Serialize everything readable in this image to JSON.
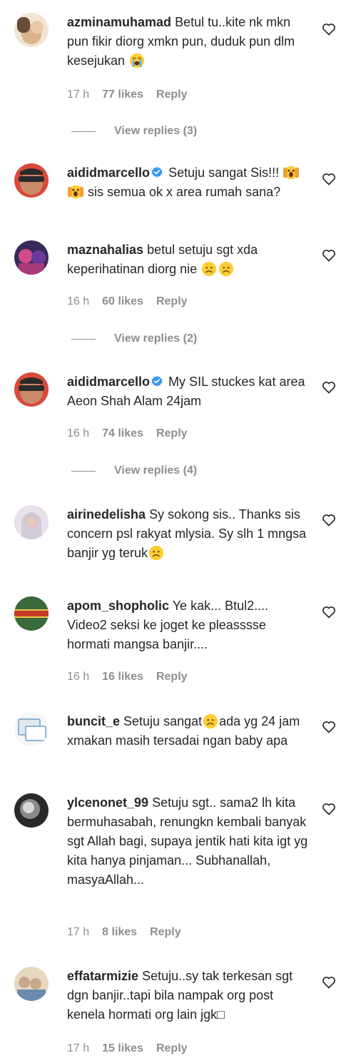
{
  "comments": [
    {
      "username": "azminamuhamad",
      "verified": false,
      "text_before": "Betul tu..kite nk mkn pun fikir diorg xmkn pun, duduk pun dlm kesejukan",
      "emojis": [
        "loudly-crying"
      ],
      "text_after": "",
      "time": "17 h",
      "likes": "77 likes",
      "reply": "Reply",
      "view_replies": "View replies (3)",
      "avatar_colors": [
        "#d9b48a",
        "#6a4b3a",
        "#f0e4d4"
      ]
    },
    {
      "username": "aididmarcello",
      "verified": true,
      "text_before": "Setuju sangat Sis!!!",
      "emojis": [
        "hands-on-cheeks",
        "hands-on-cheeks"
      ],
      "text_after": "sis semua ok x area rumah sana?",
      "time": "",
      "likes": "",
      "reply": "",
      "view_replies": "",
      "avatar_colors": [
        "#c98a6a",
        "#2a2a2a",
        "#d94a3a"
      ]
    },
    {
      "username": "maznahalias",
      "verified": false,
      "text_before": "betul setuju sgt xda keperihatinan diorg nie",
      "emojis": [
        "sad",
        "sad"
      ],
      "text_after": "",
      "time": "16 h",
      "likes": "60 likes",
      "reply": "Reply",
      "view_replies": "View replies (2)",
      "avatar_colors": [
        "#6a3a9a",
        "#d24a8a",
        "#3a2a5a"
      ]
    },
    {
      "username": "aididmarcello",
      "verified": true,
      "text_before": "My SIL stuckes kat area Aeon Shah Alam 24jam",
      "emojis": [],
      "text_after": "",
      "time": "16 h",
      "likes": "74 likes",
      "reply": "Reply",
      "view_replies": "View replies (4)",
      "avatar_colors": [
        "#c98a6a",
        "#2a2a2a",
        "#d94a3a"
      ]
    },
    {
      "username": "airinedelisha",
      "verified": false,
      "text_before": "Sy sokong sis.. Thanks sis concern psl rakyat mlysia. Sy slh 1 mngsa banjir yg teruk",
      "emojis": [
        "sad"
      ],
      "text_after": "",
      "time": "",
      "likes": "",
      "reply": "",
      "view_replies": "",
      "avatar_colors": [
        "#cfc4d8",
        "#8a7a9a",
        "#e8e0ea"
      ]
    },
    {
      "username": "apom_shopholic",
      "verified": false,
      "text_before": "Ye kak... Btul2.... Video2 seksi ke joget ke pleasssse hormati mangsa banjir....",
      "emojis": [],
      "text_after": "",
      "time": "16 h",
      "likes": "16 likes",
      "reply": "Reply",
      "view_replies": "",
      "avatar_colors": [
        "#3a6a3a",
        "#c83a2a",
        "#e8c84a"
      ]
    },
    {
      "username": "buncit_e",
      "verified": false,
      "text_before": "Setuju sangat",
      "emojis": [
        "sad"
      ],
      "text_after": "ada yg 24 jam xmakan masih tersadai ngan baby apa",
      "time": "",
      "likes": "",
      "reply": "",
      "view_replies": "",
      "avatar_colors": [
        "#dfe8ee",
        "#6aa0c8",
        "#f4f6f8"
      ]
    },
    {
      "username": "ylcenonet_99",
      "verified": false,
      "text_before": "Setuju sgt.. sama2 lh kita bermuhasabah, renungkn kembali banyak sgt Allah bagi, supaya jentik hati kita igt yg kita hanya pinjaman... Subhanallah, masyaAllah...",
      "emojis": [],
      "text_after": "",
      "time": "17 h",
      "likes": "8 likes",
      "reply": "Reply",
      "view_replies": "",
      "avatar_colors": [
        "#2a2a2a",
        "#8a8a8a",
        "#d8d8d8"
      ]
    },
    {
      "username": "effatarmizie",
      "verified": false,
      "text_before": "Setuju..sy tak terkesan sgt dgn banjir..tapi bila nampak org post kenela hormati org lain jgk□",
      "emojis": [],
      "text_after": "",
      "time": "17 h",
      "likes": "15 likes",
      "reply": "Reply",
      "view_replies": "",
      "avatar_colors": [
        "#e8d8c0",
        "#6a8ab0",
        "#c8a88a"
      ]
    }
  ],
  "colors": {
    "text": "#262626",
    "meta": "#8e8e8e",
    "verified_badge": "#3897f0",
    "emoji_face": "#ffcc33"
  }
}
